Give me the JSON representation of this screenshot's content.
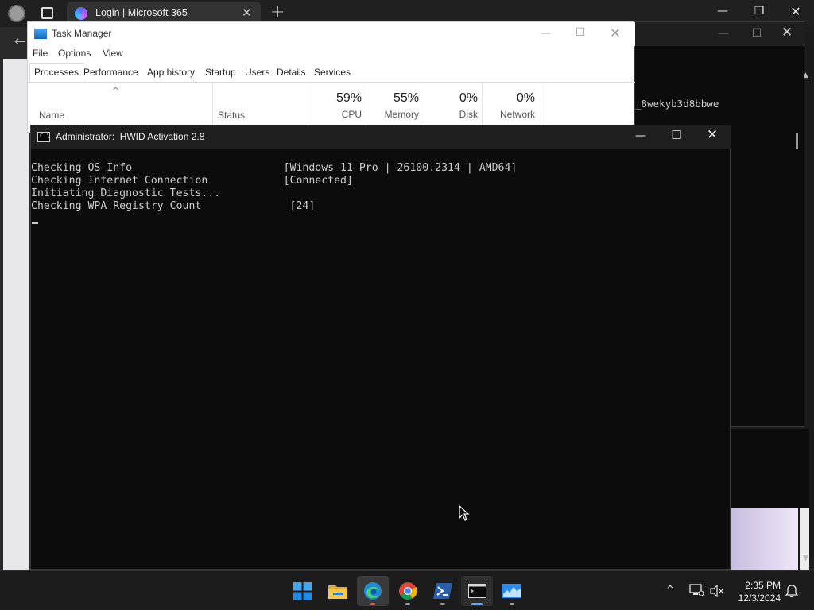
{
  "browser": {
    "tab_title": "Login | Microsoft 365",
    "tab_close": "✕",
    "new_tab": "+",
    "min": "—",
    "max": "❐",
    "close": "✕"
  },
  "background_console": {
    "text": "_8wekyb3d8bbwe",
    "min": "—",
    "max": "☐",
    "close": "✕"
  },
  "task_manager": {
    "title": "Task Manager",
    "min": "—",
    "max": "☐",
    "close": "✕",
    "menu": [
      "File",
      "Options",
      "View"
    ],
    "tabs": [
      "Processes",
      "Performance",
      "App history",
      "Startup",
      "Users",
      "Details",
      "Services"
    ],
    "sort_indicator": "^",
    "columns": {
      "name": "Name",
      "status": "Status",
      "cpu": {
        "value": "59%",
        "label": "CPU"
      },
      "memory": {
        "value": "55%",
        "label": "Memory"
      },
      "disk": {
        "value": "0%",
        "label": "Disk"
      },
      "network": {
        "value": "0%",
        "label": "Network"
      }
    }
  },
  "console": {
    "title": "Administrator:  HWID Activation 2.8",
    "min": "—",
    "max": "☐",
    "close": "✕",
    "icon_text": "C:\\",
    "lines": [
      "Checking OS Info                        [Windows 11 Pro | 26100.2314 | AMD64]",
      "Checking Internet Connection            [Connected]",
      "Initiating Diagnostic Tests...",
      "Checking WPA Registry Count              [24]"
    ]
  },
  "taskbar": {
    "apps": [
      "start-icon",
      "file-explorer-icon",
      "edge-icon",
      "chrome-icon",
      "powershell-icon",
      "terminal-icon",
      "task-manager-icon"
    ],
    "tray_chevron": "^",
    "time": "2:35 PM",
    "date": "12/3/2024"
  },
  "colors": {
    "console_bg": "#0c0c0c",
    "console_text": "#cccccc",
    "taskbar_bg": "#1c1c1c",
    "accent_blue": "#0078d4"
  }
}
